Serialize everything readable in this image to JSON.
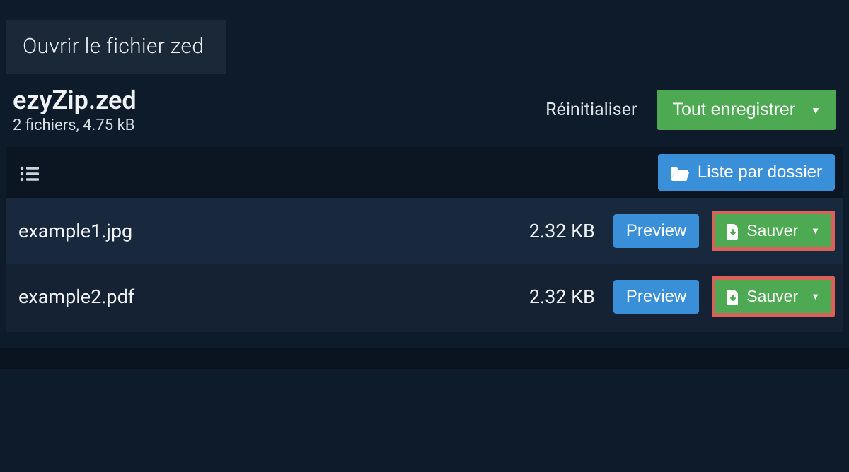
{
  "tab": {
    "label": "Ouvrir le fichier zed"
  },
  "fileInfo": {
    "name": "ezyZip.zed",
    "summary": "2 fichiers, 4.75 kB"
  },
  "headerActions": {
    "reset": "Réinitialiser",
    "saveAll": "Tout enregistrer"
  },
  "tableHeader": {
    "folderList": "Liste par dossier"
  },
  "files": [
    {
      "name": "example1.jpg",
      "size": "2.32 KB",
      "preview": "Preview",
      "save": "Sauver"
    },
    {
      "name": "example2.pdf",
      "size": "2.32 KB",
      "preview": "Preview",
      "save": "Sauver"
    }
  ]
}
